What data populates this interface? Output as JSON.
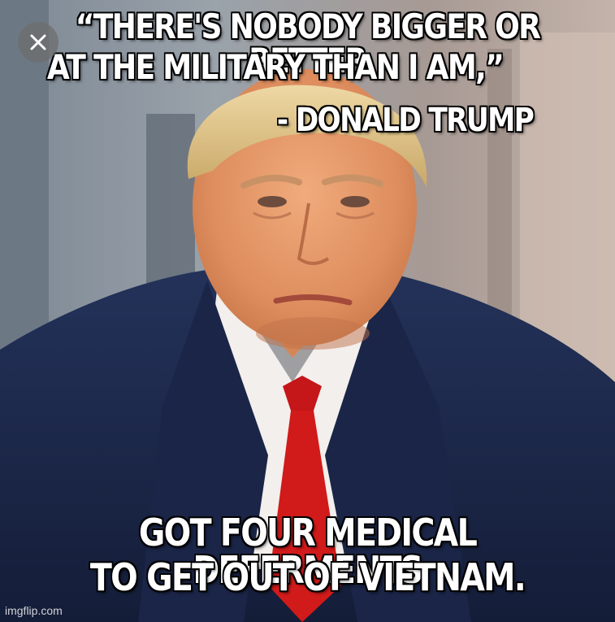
{
  "meme": {
    "top_text_line1": "“THERE'S NOBODY BIGGER OR BETTER",
    "top_text_line2": "AT THE MILITARY THAN I AM,”",
    "attribution": "- DONALD TRUMP",
    "bottom_text_line1": "GOT FOUR MEDICAL DEFERMENTS",
    "bottom_text_line2": "TO GET OUT OF VIETNAM.",
    "watermark": "imgflip.com"
  },
  "controls": {
    "close_icon": "close-icon"
  },
  "colors": {
    "caption_text": "#ffffff",
    "caption_outline": "#000000",
    "suit": "#1c2a4e",
    "tie": "#d11a1a",
    "shirt": "#f2efec",
    "skin": "#e59a6b",
    "hair": "#e2c78a",
    "background_left": "#8a94a0",
    "background_right": "#b0a19a"
  }
}
